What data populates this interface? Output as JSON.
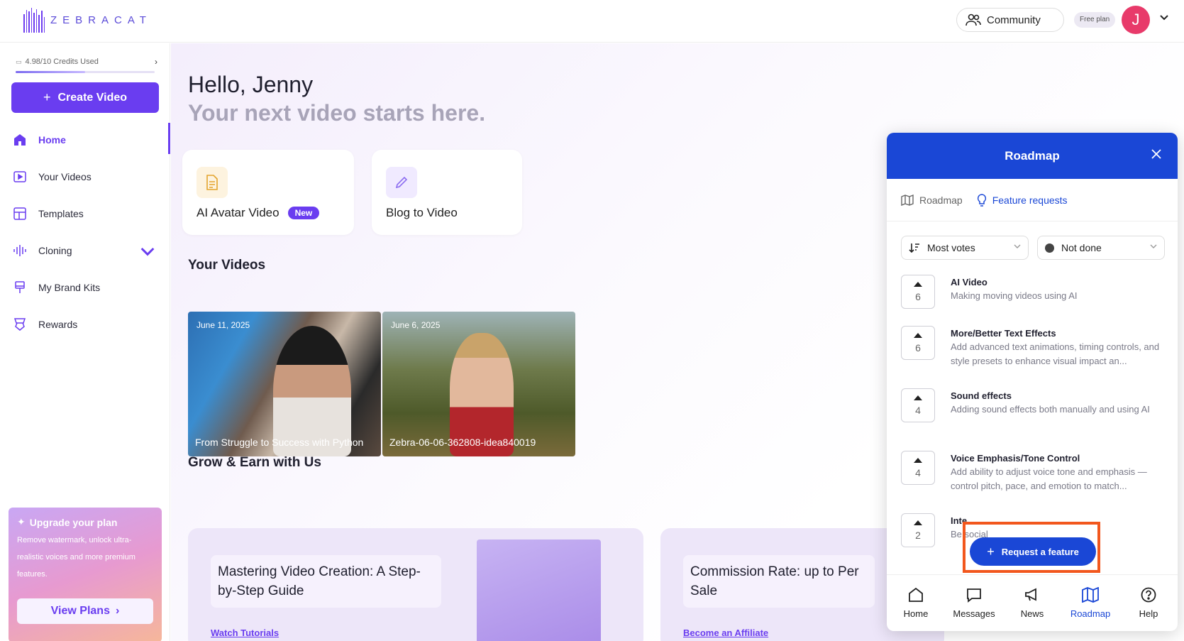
{
  "header": {
    "logo_text": "ZEBRACAT",
    "community_label": "Community",
    "plan_badge": "Free plan",
    "avatar_initial": "J"
  },
  "sidebar": {
    "credits_text": "4.98/10 Credits Used",
    "credits_used_fraction": 0.498,
    "create_button": "Create Video",
    "nav": [
      {
        "label": "Home",
        "icon": "home-icon",
        "active": true
      },
      {
        "label": "Your Videos",
        "icon": "video-icon"
      },
      {
        "label": "Templates",
        "icon": "templates-icon"
      },
      {
        "label": "Cloning",
        "icon": "waveform-icon"
      },
      {
        "label": "My Brand Kits",
        "icon": "brand-kit-icon"
      },
      {
        "label": "Rewards",
        "icon": "trophy-icon"
      }
    ],
    "upgrade": {
      "title": "Upgrade your plan",
      "description": "Remove watermark, unlock ultra-realistic voices and more premium features.",
      "button": "View Plans"
    }
  },
  "main": {
    "greeting": "Hello, Jenny",
    "tagline": "Your next video starts here.",
    "cards": [
      {
        "label": "AI Avatar Video",
        "badge": "New"
      },
      {
        "label": "Blog to Video"
      }
    ],
    "your_videos_title": "Your Videos",
    "videos": [
      {
        "date": "June 11, 2025",
        "title": "From Struggle to Success with Python"
      },
      {
        "date": "June 6, 2025",
        "title": "Zebra-06-06-362808-idea840019"
      }
    ],
    "grow_title": "Grow & Earn with Us",
    "grow_cards": [
      {
        "text": "Mastering Video Creation: A Step-by-Step Guide",
        "link": "Watch Tutorials"
      },
      {
        "text": "Commission Rate: up to Per Sale",
        "link": "Become an Affiliate"
      }
    ]
  },
  "roadmap_panel": {
    "title": "Roadmap",
    "tabs": [
      {
        "label": "Roadmap",
        "icon": "map-icon"
      },
      {
        "label": "Feature requests",
        "icon": "lightbulb-icon",
        "active": true
      }
    ],
    "sort_filter": "Most votes",
    "status_filter": "Not done",
    "requests": [
      {
        "votes": "6",
        "title": "AI Video",
        "desc": "Making moving videos using AI"
      },
      {
        "votes": "6",
        "title": "More/Better Text Effects",
        "desc": "Add advanced text animations, timing controls, and style presets to enhance visual impact an..."
      },
      {
        "votes": "4",
        "title": "Sound effects",
        "desc": "Adding sound effects both manually and using AI"
      },
      {
        "votes": "4",
        "title": "Voice Emphasis/Tone Control",
        "desc": "Add ability to adjust voice tone and emphasis —control pitch, pace, and emotion to match..."
      },
      {
        "votes": "2",
        "title": "Inte",
        "desc": "Be social"
      }
    ],
    "request_button": "Request a feature",
    "footer": [
      {
        "label": "Home",
        "icon": "home-icon"
      },
      {
        "label": "Messages",
        "icon": "message-icon"
      },
      {
        "label": "News",
        "icon": "megaphone-icon"
      },
      {
        "label": "Roadmap",
        "icon": "map-icon",
        "active": true
      },
      {
        "label": "Help",
        "icon": "help-icon"
      }
    ]
  }
}
